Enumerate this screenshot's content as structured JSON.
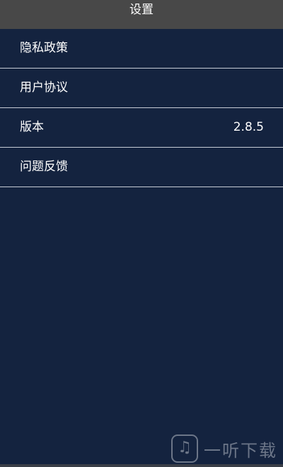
{
  "header": {
    "title": "设置"
  },
  "settings": {
    "items": [
      {
        "label": "隐私政策",
        "value": ""
      },
      {
        "label": "用户协议",
        "value": ""
      },
      {
        "label": "版本",
        "value": "2.8.5"
      },
      {
        "label": "问题反馈",
        "value": ""
      }
    ]
  },
  "watermark": {
    "text": "一听下载"
  },
  "colors": {
    "background": "#14233f",
    "titlebar": "#484848",
    "divider": "#c7ccd6"
  }
}
